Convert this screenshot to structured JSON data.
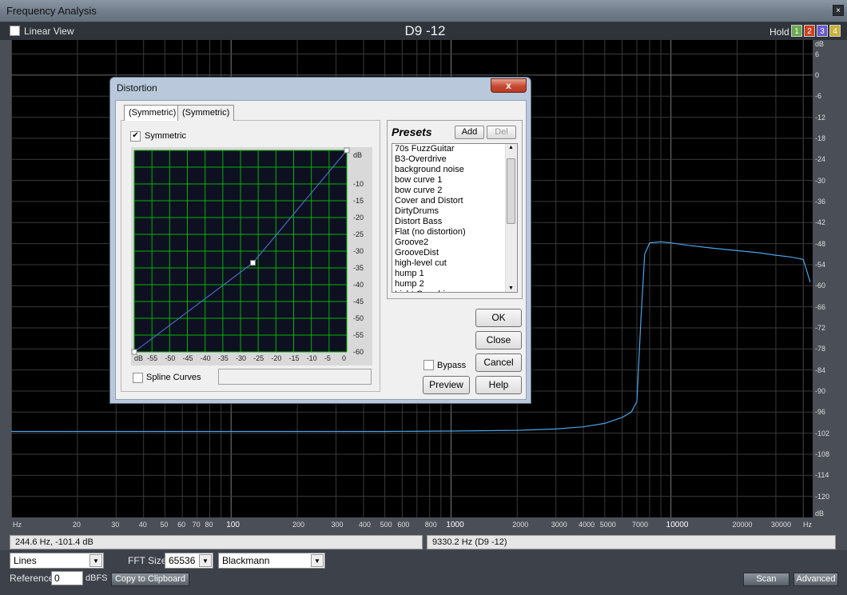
{
  "window": {
    "title": "Frequency Analysis",
    "close": "×"
  },
  "toolbar": {
    "linear_view_label": "Linear View",
    "linear_view_checked": false,
    "plot_title": "D9 -12",
    "hold_label": "Hold",
    "hold_buttons": [
      {
        "label": "1",
        "color": "#6aa84f"
      },
      {
        "label": "2",
        "color": "#cc4125"
      },
      {
        "label": "3",
        "color": "#6a5acd"
      },
      {
        "label": "4",
        "color": "#c9b037"
      }
    ]
  },
  "plot": {
    "db_labels": [
      "dB",
      "6",
      "0",
      "-6",
      "-12",
      "-18",
      "-24",
      "-30",
      "-36",
      "-42",
      "-48",
      "-54",
      "-60",
      "-66",
      "-72",
      "-78",
      "-84",
      "-90",
      "-96",
      "-102",
      "-108",
      "-114",
      "-120",
      "dB"
    ],
    "freq_labels": [
      "Hz",
      "20",
      "30",
      "40",
      "50",
      "60",
      "70",
      "80",
      "100",
      "200",
      "300",
      "400",
      "500",
      "600",
      "800",
      "1000",
      "2000",
      "3000",
      "4000",
      "5000",
      "7000",
      "10000",
      "20000",
      "30000",
      "Hz"
    ],
    "line_color": "#4aa3e8"
  },
  "chart_data": {
    "type": "line",
    "title": "D9 -12",
    "xlabel": "Hz",
    "ylabel": "dB",
    "x_scale": "log",
    "xlim": [
      10,
      44100
    ],
    "ylim": [
      -126,
      10
    ],
    "grid": true,
    "series": [
      {
        "x": [
          10,
          100,
          500,
          1000,
          2000,
          3000,
          4000,
          5000,
          6000,
          6600,
          7000,
          7300,
          7600,
          8000,
          9000,
          10000,
          12000,
          15000,
          20000,
          25000,
          30000,
          35000,
          40000,
          43000
        ],
        "values": [
          -101.5,
          -101.5,
          -101.5,
          -101.4,
          -101.2,
          -100.8,
          -100.2,
          -99.2,
          -97.5,
          -96.0,
          -93,
          -70,
          -51,
          -47.8,
          -47.5,
          -47.8,
          -48.5,
          -49.2,
          -50.0,
          -50.6,
          -51.3,
          -51.8,
          -52.5,
          -59
        ]
      }
    ]
  },
  "status": {
    "left": "244.6 Hz, -101.4 dB",
    "right": "9330.2 Hz (D9 -12)"
  },
  "bottom": {
    "display_mode": "Lines",
    "fft_size_label": "FFT Size",
    "fft_size": "65536",
    "window_fn": "Blackmann",
    "reference_label": "Reference",
    "reference_value": "0",
    "dbfs_label": "dBFS",
    "copy_button": "Copy to Clipboard",
    "scan_button": "Scan",
    "advanced_button": "Advanced"
  },
  "dialog": {
    "title": "Distortion",
    "close": "x",
    "tabs": [
      "(Symmetric)",
      "(Symmetric)"
    ],
    "symmetric_label": "Symmetric",
    "symmetric_checked": true,
    "graph": {
      "y_labels": [
        "dB",
        "-10",
        "-15",
        "-20",
        "-25",
        "-30",
        "-35",
        "-40",
        "-45",
        "-50",
        "-55",
        "-60"
      ],
      "x_labels": [
        "dB",
        "-55",
        "-50",
        "-45",
        "-40",
        "-35",
        "-30",
        "-25",
        "-20",
        "-15",
        "-10",
        "-5",
        "0"
      ],
      "curve_points_db": [
        [
          -60,
          -60
        ],
        [
          -26.5,
          -33.5
        ],
        [
          0,
          0
        ]
      ],
      "curve_color": "#4a7fd6",
      "grid_color": "#00b400",
      "bg_color": "#0f0f22"
    },
    "spline_label": "Spline Curves",
    "spline_checked": false,
    "presets": {
      "title": "Presets",
      "add": "Add",
      "del": "Del",
      "items": [
        "70s FuzzGuitar",
        "B3-Overdrive",
        "background noise",
        "bow curve 1",
        "bow curve 2",
        "Cover and Distort",
        "DirtyDrums",
        "Distort Bass",
        "Flat (no distortion)",
        "Groove2",
        "GrooveDist",
        "high-level cut",
        "hump 1",
        "hump 2",
        "Light Overdrive"
      ]
    },
    "bypass_label": "Bypass",
    "bypass_checked": false,
    "buttons": {
      "ok": "OK",
      "close": "Close",
      "cancel": "Cancel",
      "preview": "Preview",
      "help": "Help"
    }
  }
}
